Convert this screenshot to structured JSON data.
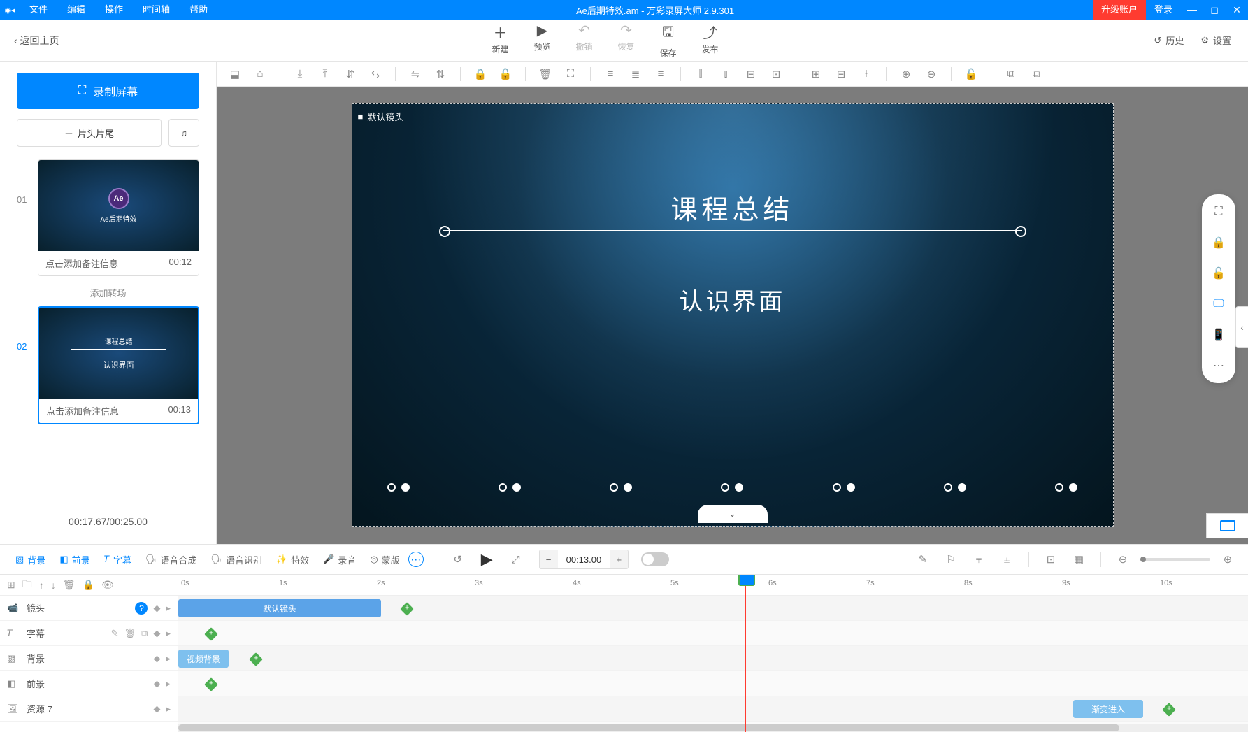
{
  "titlebar": {
    "menus": [
      "文件",
      "编辑",
      "操作",
      "时间轴",
      "帮助"
    ],
    "filename": "Ae后期特效.am",
    "appname": "万彩录屏大师 2.9.301",
    "upgrade": "升级账户",
    "login": "登录"
  },
  "toolbar": {
    "back": "返回主页",
    "items": [
      {
        "icon": "＋",
        "label": "新建"
      },
      {
        "icon": "▶",
        "label": "预览"
      },
      {
        "icon": "↶",
        "label": "撤销",
        "disabled": true
      },
      {
        "icon": "↷",
        "label": "恢复",
        "disabled": true
      },
      {
        "icon": "🖫",
        "label": "保存"
      },
      {
        "icon": "⤴",
        "label": "发布"
      }
    ],
    "right": [
      {
        "icon": "↺",
        "label": "历史"
      },
      {
        "icon": "⚙",
        "label": "设置"
      }
    ]
  },
  "sidebar": {
    "record_label": "录制屏幕",
    "intro_label": "片头片尾",
    "scenes": [
      {
        "num": "01",
        "note_placeholder": "点击添加备注信息",
        "duration": "00:12",
        "thumb_text": "Ae后期特效"
      },
      {
        "num": "02",
        "note_placeholder": "点击添加备注信息",
        "duration": "00:13",
        "thumb_t1": "课程总结",
        "thumb_t2": "认识界面",
        "active": true
      }
    ],
    "add_transition": "添加转场",
    "time": "00:17.67/00:25.00"
  },
  "canvas": {
    "shot_label": "默认镜头",
    "title": "课程总结",
    "subtitle": "认识界面"
  },
  "timeline_controls": {
    "tabs": [
      {
        "icon": "▨",
        "label": "背景"
      },
      {
        "icon": "◧",
        "label": "前景"
      },
      {
        "icon": "𝑇",
        "label": "字幕",
        "active": true
      },
      {
        "icon": "🗣",
        "label": "语音合成"
      },
      {
        "icon": "🗣",
        "label": "语音识别"
      },
      {
        "icon": "✨",
        "label": "特效"
      },
      {
        "icon": "🎤",
        "label": "录音"
      },
      {
        "icon": "◎",
        "label": "蒙版"
      }
    ],
    "time_value": "00:13.00"
  },
  "timeline": {
    "ticks": [
      "0s",
      "1s",
      "2s",
      "3s",
      "4s",
      "5s",
      "6s",
      "7s",
      "8s",
      "9s",
      "10s"
    ],
    "rows": [
      {
        "icon": "📹",
        "name": "镜头",
        "help": true
      },
      {
        "icon": "𝑇",
        "name": "字幕",
        "extra_icons": true
      },
      {
        "icon": "▨",
        "name": "背景"
      },
      {
        "icon": "◧",
        "name": "前景"
      },
      {
        "icon": "🖼",
        "name": "资源 7"
      }
    ],
    "clip_shot": "默认镜头",
    "clip_bg": "视频背景",
    "clip_enter": "渐变进入"
  }
}
